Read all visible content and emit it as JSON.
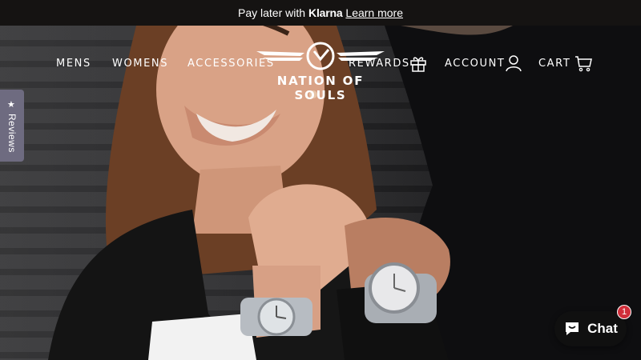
{
  "announcement": {
    "prefix": "Pay later with",
    "brand": "Klarna",
    "link": "Learn more"
  },
  "nav": {
    "left_items": [
      "MENS",
      "WOMENS",
      "ACCESSORIES"
    ],
    "rewards_label": "REWARDS",
    "account_label": "ACCOUNT",
    "cart_label": "CART"
  },
  "logo": {
    "text": "NATION OF SOULS"
  },
  "reviews_tab": {
    "label": "Reviews"
  },
  "chat": {
    "label": "Chat",
    "badge_count": "1"
  },
  "colors": {
    "announcement_bg": "#151312",
    "reviews_tab_bg": "#6e6b80",
    "chat_bg": "#101010",
    "badge": "#d02e3a"
  }
}
